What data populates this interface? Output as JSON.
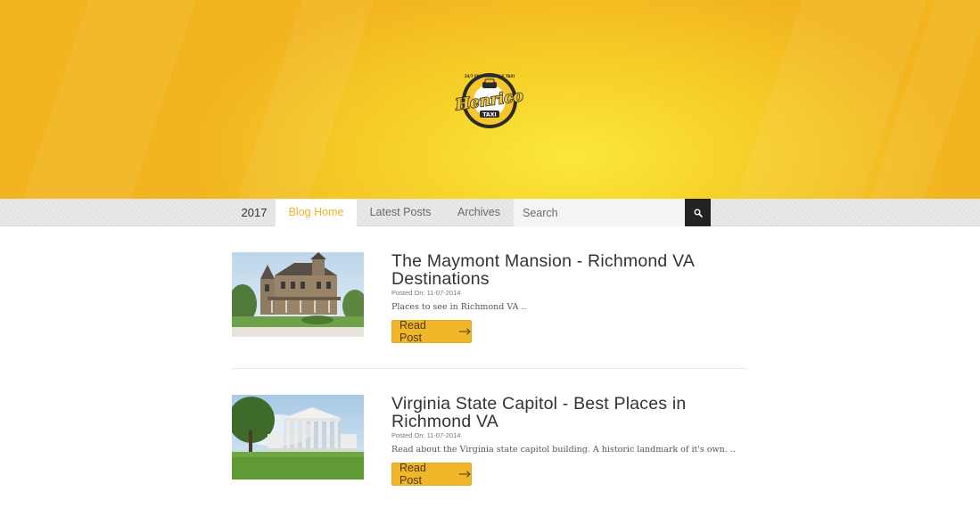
{
  "brand": {
    "logo_name": "Henrico",
    "logo_sub": "TAXI",
    "logo_tagline": "24/7 FAST RELIABLE TAXI"
  },
  "nav": {
    "year": "2017",
    "items": [
      {
        "label": "Blog Home",
        "active": true
      },
      {
        "label": "Latest Posts",
        "active": false
      },
      {
        "label": "Archives",
        "active": false
      }
    ],
    "search_placeholder": "Search"
  },
  "posts": [
    {
      "title": "The Maymont Mansion - Richmond VA Destinations",
      "meta": "Posted On: 11-07-2014",
      "excerpt": "Places to see in Richmond VA ..",
      "button": "Read Post"
    },
    {
      "title": "Virginia State Capitol - Best Places in Richmond VA",
      "meta": "Posted On: 11-07-2014",
      "excerpt": "Read about the Virginia state capitol building. A historic landmark of it's own. ..",
      "button": "Read Post"
    }
  ],
  "colors": {
    "accent": "#f2b62a",
    "hero": "#f7d42b",
    "dark": "#222222"
  }
}
